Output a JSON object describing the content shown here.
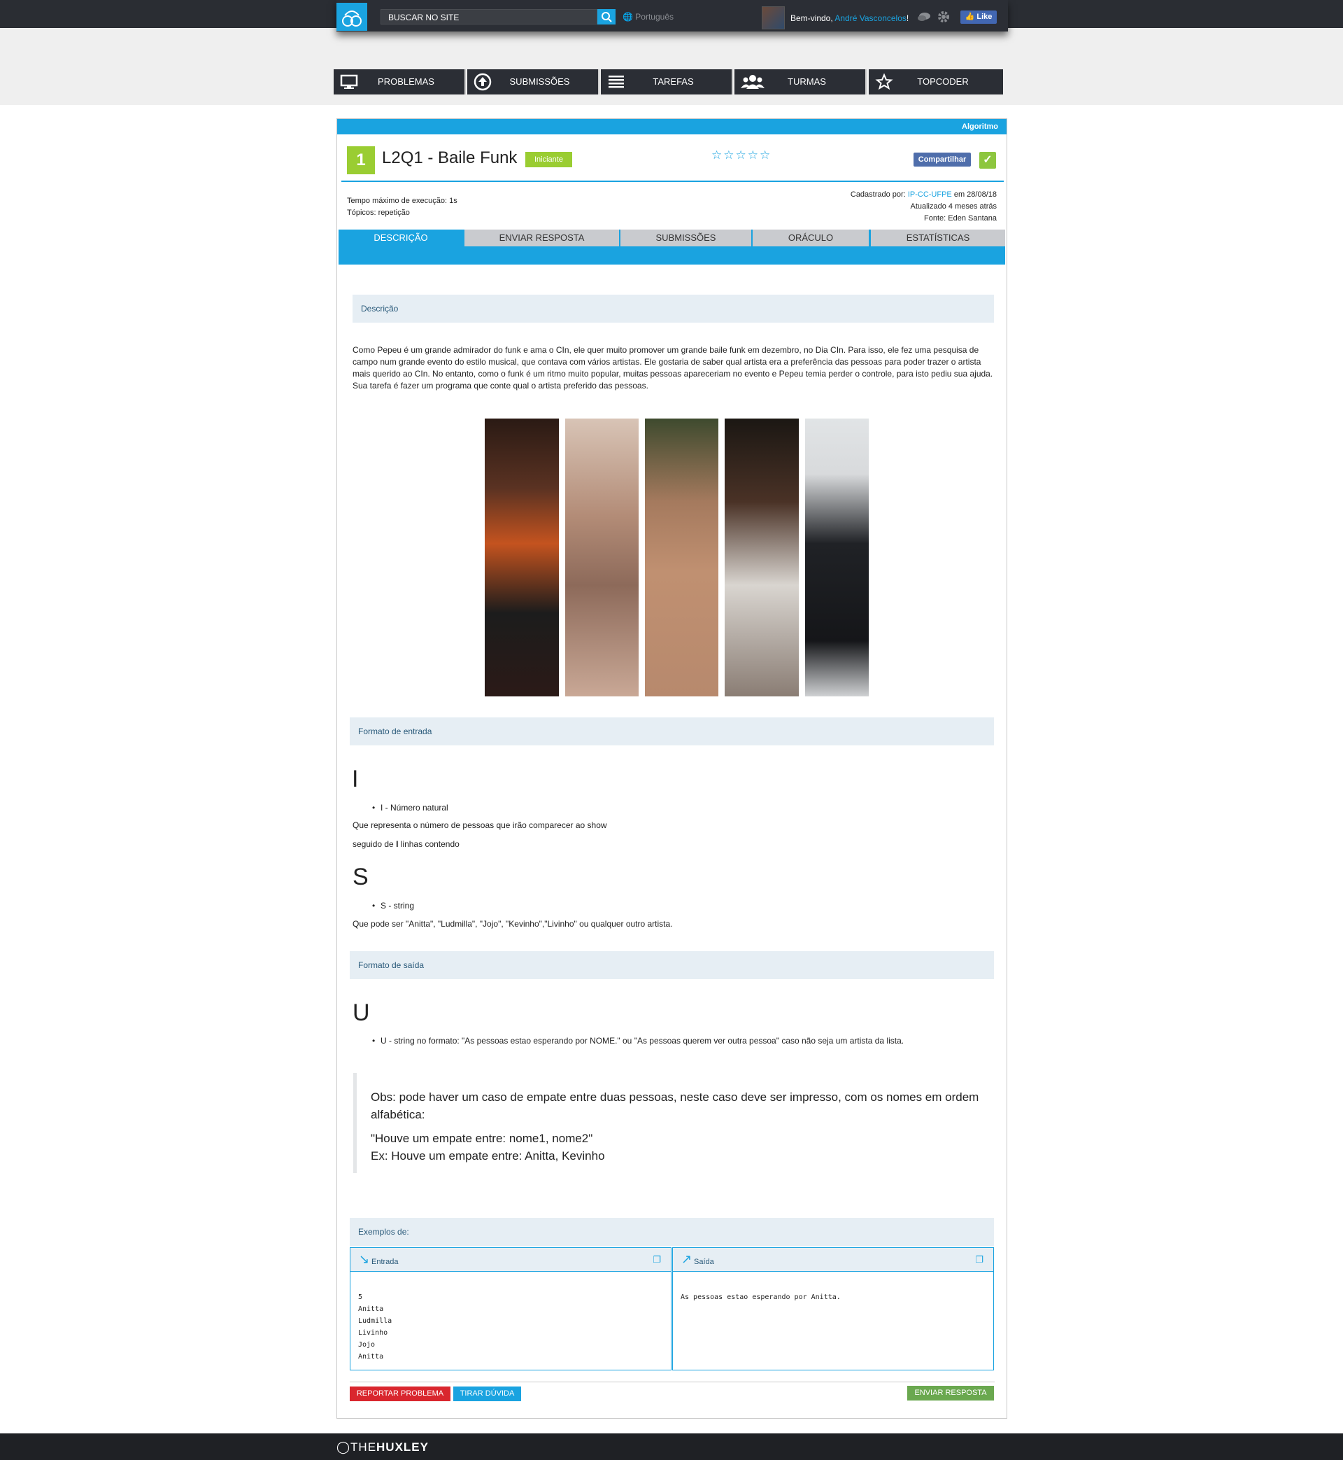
{
  "header": {
    "search_placeholder": "BUSCAR NO SITE",
    "language": "Português",
    "welcome_prefix": "Bem-vindo,",
    "user_name": "André Vasconcelos",
    "welcome_suffix": "!",
    "like_label": "Like"
  },
  "nav": [
    {
      "label": "PROBLEMAS",
      "icon": "monitor-icon"
    },
    {
      "label": "SUBMISSÕES",
      "icon": "upload-circle-icon"
    },
    {
      "label": "TAREFAS",
      "icon": "list-icon"
    },
    {
      "label": "TURMAS",
      "icon": "users-icon"
    },
    {
      "label": "TOPCODER",
      "icon": "star-outline-icon"
    }
  ],
  "problem": {
    "category": "Algoritmo",
    "number": "1",
    "title": "L2Q1 - Baile Funk",
    "level": "Iniciante",
    "rating_stars": "☆☆☆☆☆",
    "share_label": "Compartilhar",
    "exec_time": "Tempo máximo de execução: 1s",
    "topics": "Tópicos: repetição",
    "registered_by_prefix": "Cadastrado por:",
    "registered_by": "IP-CC-UFPE",
    "registered_on": "em 28/08/18",
    "updated": "Atualizado 4 meses atrás",
    "source": "Fonte: Eden Santana"
  },
  "tabs": [
    "DESCRIÇÃO",
    "ENVIAR RESPOSTA",
    "SUBMISSÕES",
    "ORÁCULO",
    "ESTATÍSTICAS"
  ],
  "description": {
    "header": "Descrição",
    "text": "Como Pepeu é um grande admirador do funk e ama o CIn, ele quer muito promover um grande baile funk em dezembro, no Dia CIn. Para isso, ele fez uma pesquisa de campo num grande evento do estilo musical, que contava com vários artistas. Ele gostaria de saber qual artista era a preferência das pessoas para poder trazer o artista mais querido ao CIn. No entanto, como o funk é um ritmo muito popular, muitas pessoas apareceriam no evento e Pepeu temia perder o controle, para isto pediu sua ajuda. Sua tarefa é fazer um programa que conte qual o artista preferido das pessoas."
  },
  "input_format": {
    "header": "Formato de entrada",
    "letter1": "I",
    "bullet1": "I - Número natural",
    "line1": "Que representa o número de pessoas que irão comparecer ao show",
    "line2_prefix": "seguido de",
    "line2_bold": "I",
    "line2_suffix": "linhas contendo",
    "letter2": "S",
    "bullet2": "S - string",
    "line3": "Que pode ser \"Anitta\", \"Ludmilla\", \"Jojo\", \"Kevinho\",\"Livinho\" ou qualquer outro artista."
  },
  "output_format": {
    "header": "Formato de saída",
    "letter": "U",
    "bullet": "U - string no formato: \"As pessoas estao esperando por NOME.\" ou \"As pessoas querem ver outra pessoa\" caso não seja um artista da lista."
  },
  "obs": {
    "line1": "Obs: pode haver um caso de empate entre duas pessoas, neste caso deve ser impresso, com os nomes em ordem alfabética:",
    "line2": "\"Houve um empate entre: nome1, nome2\"",
    "line3": "Ex: Houve um empate entre: Anitta, Kevinho"
  },
  "examples": {
    "header": "Exemplos de:",
    "input_label": "Entrada",
    "output_label": "Saída",
    "input": "5\nAnitta\nLudmilla\nLivinho\nJojo\nAnitta",
    "output": "As pessoas estao esperando por Anitta."
  },
  "buttons": {
    "report": "REPORTAR PROBLEMA",
    "doubt": "TIRAR DÚVIDA",
    "submit": "ENVIAR RESPOSTA"
  },
  "footer": {
    "brand_light": "THE",
    "brand_bold": "HUXLEY"
  },
  "colors": {
    "accent": "#1aa3e0",
    "level_green": "#9acd32",
    "report_red": "#d9262e",
    "submit_green": "#6aa84f",
    "dark_bar": "#2b2e35"
  }
}
